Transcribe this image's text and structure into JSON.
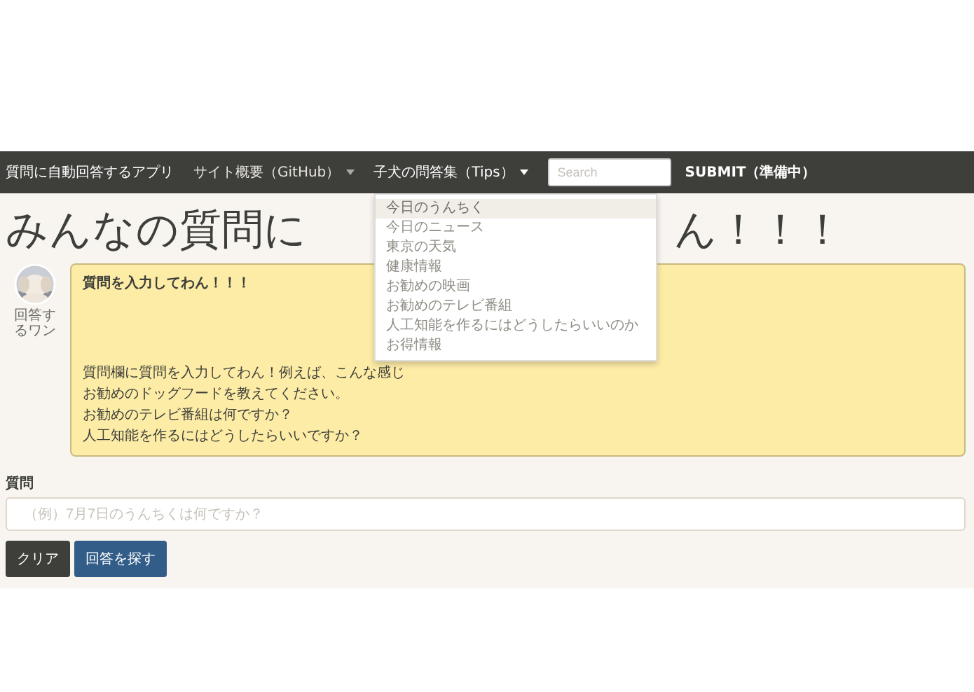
{
  "navbar": {
    "brand": "質問に自動回答するアプリ",
    "items": [
      {
        "label": "サイト概要（GitHub）",
        "kind": "dropdown",
        "expanded": false
      },
      {
        "label": "子犬の問答集（Tips）",
        "kind": "dropdown",
        "expanded": true
      }
    ],
    "search": {
      "placeholder": "Search"
    },
    "submit": "SUBMIT（準備中）"
  },
  "dropdown_menu": [
    {
      "label": "今日のうんちく",
      "selected": true
    },
    {
      "label": "今日のニュース",
      "selected": false
    },
    {
      "label": "東京の天気",
      "selected": false
    },
    {
      "label": "健康情報",
      "selected": false
    },
    {
      "label": "お勧めの映画",
      "selected": false
    },
    {
      "label": "お勧めのテレビ番組",
      "selected": false
    },
    {
      "label": "人工知能を作るにはどうしたらいいのか",
      "selected": false
    },
    {
      "label": "お得情報",
      "selected": false
    }
  ],
  "heading": {
    "start": "みんなの質問に",
    "end": "ん！！！"
  },
  "bot": {
    "name": "回答するワン",
    "title": "質問を入力してわん！！！",
    "intro": "質問欄に質問を入力してわん！例えば、こんな感じ",
    "examples": [
      "お勧めのドッグフードを教えてください。",
      "お勧めのテレビ番組は何ですか？",
      "人工知能を作るにはどうしたらいいですか？"
    ]
  },
  "form": {
    "label": "質問",
    "placeholder": "（例）7月7日のうんちくは何ですか？",
    "buttons": [
      {
        "label": "クリア",
        "kind": "secondary"
      },
      {
        "label": "回答を探す",
        "kind": "primary"
      }
    ]
  }
}
